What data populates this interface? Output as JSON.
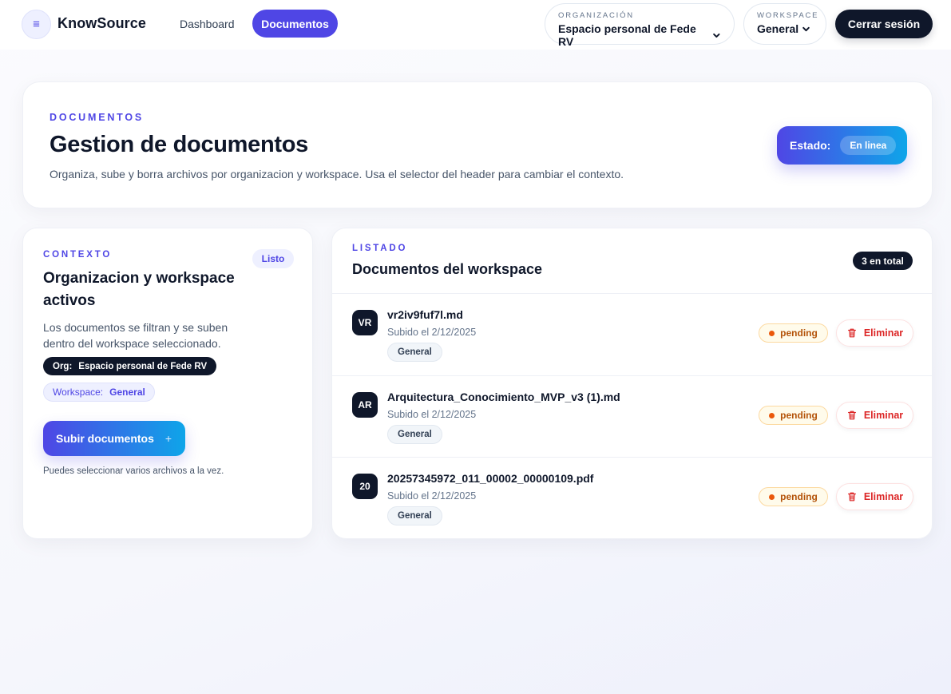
{
  "header": {
    "brand": "KnowSource",
    "menu_icon": "menu-icon",
    "nav": {
      "dashboard": "Dashboard",
      "documentos": "Documentos"
    },
    "organizacion": {
      "label": "ORGANIZACIÓN",
      "value": "Espacio personal de Fede RV"
    },
    "workspace": {
      "label": "WORKSPACE",
      "value": "General"
    },
    "logout": "Cerrar sesión"
  },
  "hero": {
    "eyebrow": "DOCUMENTOS",
    "title": "Gestion de documentos",
    "description": "Organiza, sube y borra archivos por organizacion y workspace. Usa el selector del header para cambiar el contexto.",
    "estado_label": "Estado:",
    "estado_value": "En linea"
  },
  "context": {
    "eyebrow": "CONTEXTO",
    "badge": "Listo",
    "title": "Organizacion y workspace activos",
    "description": "Los documentos se filtran y se suben dentro del workspace seleccionado.",
    "org_label": "Org:",
    "org_value": "Espacio personal de Fede RV",
    "ws_label": "Workspace:",
    "ws_value": "General",
    "upload_label": "Subir documentos",
    "upload_icon": "plus-icon",
    "hint": "Puedes seleccionar varios archivos a la vez."
  },
  "listing": {
    "eyebrow": "LISTADO",
    "title": "Documentos del workspace",
    "total": "3 en total",
    "documents": [
      {
        "initials": "VR",
        "name": "vr2iv9fuf7l.md",
        "uploaded": "Subido el 2/12/2025",
        "workspace": "General",
        "status": "pending",
        "delete_label": "Eliminar"
      },
      {
        "initials": "AR",
        "name": "Arquitectura_Conocimiento_MVP_v3 (1).md",
        "uploaded": "Subido el 2/12/2025",
        "workspace": "General",
        "status": "pending",
        "delete_label": "Eliminar"
      },
      {
        "initials": "20",
        "name": "20257345972_011_00002_00000109.pdf",
        "uploaded": "Subido el 2/12/2025",
        "workspace": "General",
        "status": "pending",
        "delete_label": "Eliminar"
      }
    ]
  },
  "colors": {
    "accent": "#4f46e5",
    "accent_end": "#0ea5e9",
    "dark": "#0f172a",
    "pending": "#b45309",
    "danger": "#dc2626"
  }
}
